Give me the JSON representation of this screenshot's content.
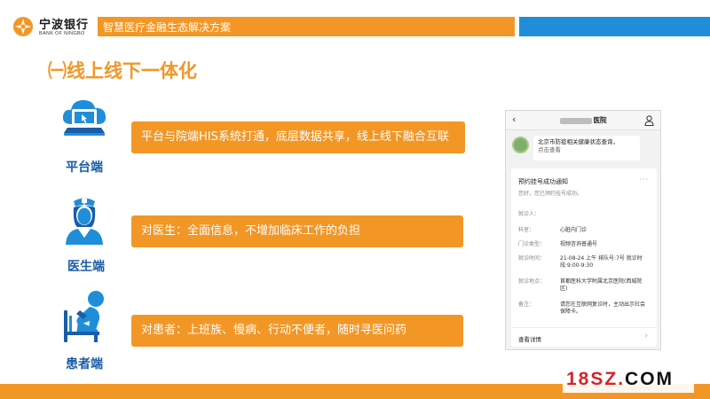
{
  "brand": {
    "name_cn": "宁波银行",
    "name_en": "BANK OF NINGBO"
  },
  "header": {
    "title": "智慧医疗金融生态解决方案"
  },
  "section": {
    "title": "㈠线上线下一体化"
  },
  "rows": [
    {
      "icon": "platform-laptop-icon",
      "label": "平台端",
      "text": "平台与院端HIS系统打通，底层数据共享，线上线下融合互联"
    },
    {
      "icon": "doctor-icon",
      "label": "医生端",
      "text": "对医生：全面信息，不增加临床工作的负担"
    },
    {
      "icon": "patient-icon",
      "label": "患者端",
      "text": "对患者：上班族、慢病、行动不便者，随时寻医问药"
    }
  ],
  "phone": {
    "back": "‹",
    "title_suffix": "医院",
    "message": {
      "line1": "北京市防疫相关健康状态查询，",
      "line2": "点击查看"
    },
    "card": {
      "title": "预约挂号成功通知",
      "dots": "···",
      "subtitle": "您好，您已预约挂号成功。",
      "rows": [
        {
          "key": "就诊人：",
          "value": ""
        },
        {
          "key": "科室：",
          "value": "心脏内门诊"
        },
        {
          "key": "门诊类型：",
          "value": "视频咨询普通号"
        },
        {
          "key": "就诊时间：",
          "value": "21-08-24 上午 排队号:7号  就诊时段:9:00-9:30"
        },
        {
          "key": "就诊地点：",
          "value": "首都医科大学附属北京医院(西城院区)"
        },
        {
          "key": "备注：",
          "value": "请您在互联网复诊时，主动出示社会保障卡。"
        }
      ],
      "more": "查看详情",
      "chevron": "›"
    }
  },
  "watermark": {
    "main": "18SZ.",
    "suffix": "COM"
  },
  "colors": {
    "accent": "#f29726",
    "blue": "#1f8ed8",
    "label_blue": "#1a5ca8"
  }
}
